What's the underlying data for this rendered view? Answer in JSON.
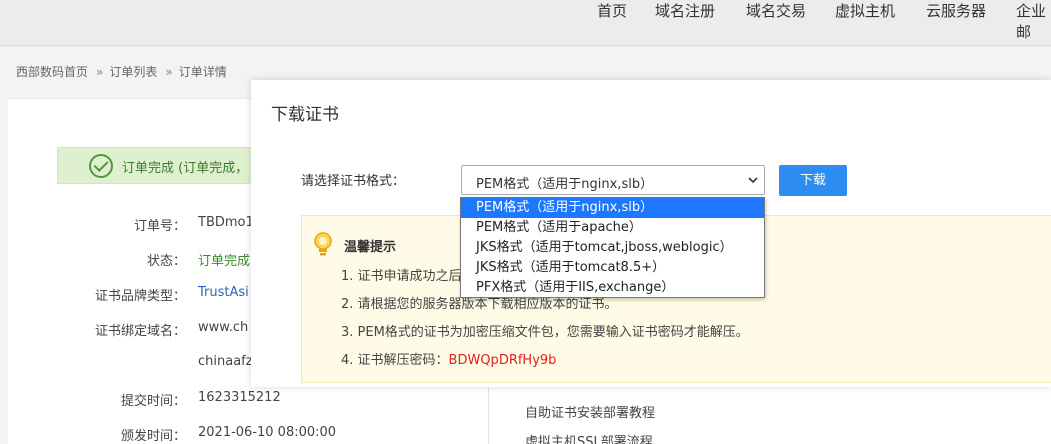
{
  "nav": {
    "items": [
      "首页",
      "域名注册",
      "域名交易",
      "虚拟主机",
      "云服务器",
      "企业邮"
    ]
  },
  "breadcrumb": {
    "items": [
      "西部数码首页",
      "订单列表",
      "订单详情"
    ],
    "separator": "»"
  },
  "order": {
    "status_banner": "订单完成 (订单完成，",
    "rows": [
      {
        "label": "订单号：",
        "value": "TBDmo1"
      },
      {
        "label": "状态：",
        "value": "订单完成"
      },
      {
        "label": "证书品牌类型：",
        "value": "TrustAsi"
      },
      {
        "label": "证书绑定域名：",
        "value": "www.ch"
      },
      {
        "label": "",
        "value": "chinaafz"
      },
      {
        "label": "提交时间：",
        "value": "1623315212"
      },
      {
        "label": "颁发时间：",
        "value": "2021-06-10 08:00:00"
      }
    ],
    "side_links": [
      "自助证书安装部署教程",
      "虚拟主机SSL部署流程"
    ]
  },
  "modal": {
    "title": "下载证书",
    "format_label": "请选择证书格式：",
    "selected_format": "PEM格式（适用于nginx,slb）",
    "download_button": "下载",
    "format_options": [
      "PEM格式（适用于nginx,slb）",
      "PEM格式（适用于apache）",
      "JKS格式（适用于tomcat,jboss,weblogic）",
      "JKS格式（适用于tomcat8.5+）",
      "PFX格式（适用于IIS,exchange）"
    ],
    "tips": {
      "title": "温馨提示",
      "line1": "1. 证书申请成功之后",
      "line2": "2. 请根据您的服务器版本下载相应版本的证书。",
      "line3": "3. PEM格式的证书为加密压缩文件包，您需要输入证书密码才能解压。",
      "line4_prefix": "4. 证书解压密码：",
      "password": "BDWQpDRfHy9b"
    }
  },
  "colors": {
    "primary": "#2d8cf0",
    "selected_option": "#1e78ff",
    "password": "#e02020",
    "success_green": "#3b8a2b",
    "tip_bg": "#fffbe6"
  }
}
